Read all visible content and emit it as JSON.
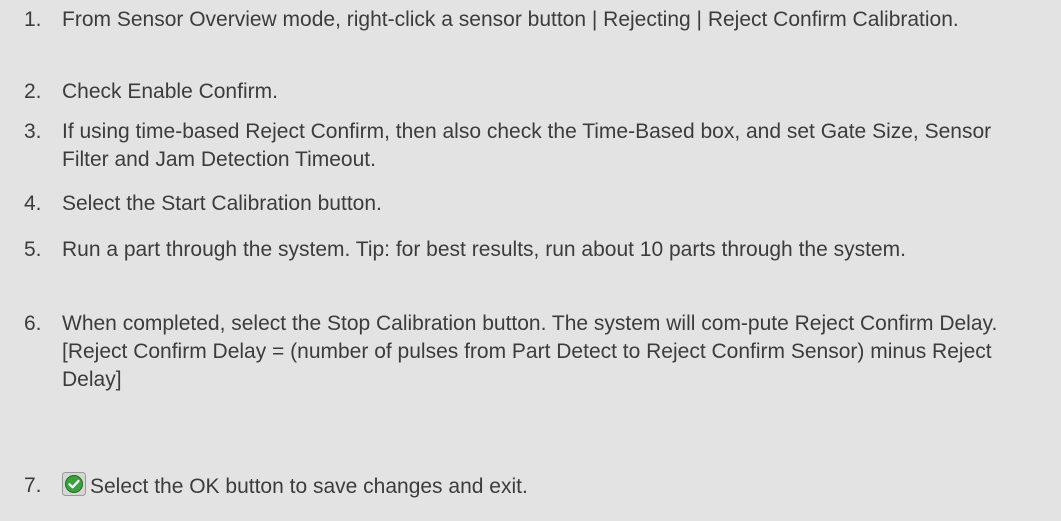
{
  "steps": [
    {
      "number": "1.",
      "text": "From Sensor Overview mode, right-click a sensor button | Rejecting | Reject Confirm Calibration."
    },
    {
      "number": "2.",
      "text": "Check Enable Confirm."
    },
    {
      "number": "3.",
      "text": "If using time-based Reject Confirm, then also check the Time-Based box, and set Gate Size, Sensor Filter and Jam Detection Timeout."
    },
    {
      "number": "4.",
      "text": "Select the Start Calibration button."
    },
    {
      "number": "5.",
      "text": "Run a part through the system. Tip: for best results, run about 10 parts through the system."
    },
    {
      "number": "6.",
      "text": "When completed, select the Stop Calibration button. The system will com-pute Reject Confirm Delay. [Reject Confirm Delay = (number of pulses from Part Detect to Reject Confirm Sensor) minus Reject Delay]"
    },
    {
      "number": "7.",
      "icon": "ok-checkmark-icon",
      "text": "Select the OK button to save changes and exit."
    }
  ],
  "colors": {
    "background": "#e3e3e3",
    "text": "#3c3c3c",
    "ok_icon_green": "#3aa23a"
  }
}
